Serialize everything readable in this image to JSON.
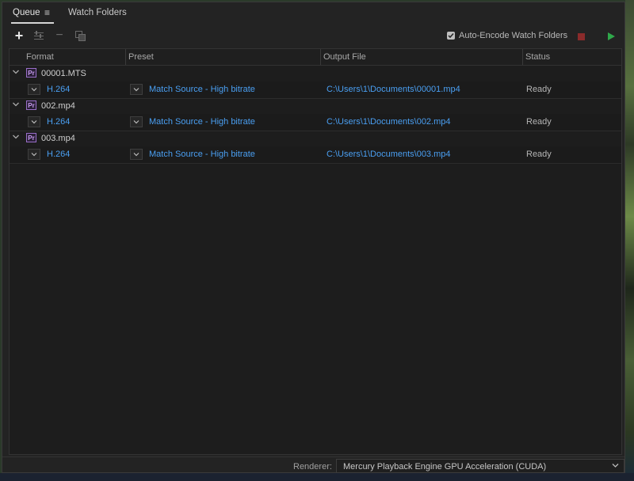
{
  "tabs": {
    "queue": "Queue",
    "menu_icon": "hamburger-menu-icon",
    "watch_folders": "Watch Folders"
  },
  "toolbar": {
    "icons": [
      "add-icon",
      "settings-icon",
      "remove-icon",
      "duplicate-icon"
    ],
    "auto_encode_label": "Auto-Encode Watch Folders",
    "auto_encode_checked": true,
    "stop_color": "#8a2b2b",
    "start_color": "#2fa84a"
  },
  "table": {
    "headers": {
      "format": "Format",
      "preset": "Preset",
      "output": "Output File",
      "status": "Status"
    },
    "groups": [
      {
        "name": "00001.MTS",
        "format": "H.264",
        "preset": "Match Source - High bitrate",
        "output": "C:\\Users\\1\\Documents\\00001.mp4",
        "status": "Ready"
      },
      {
        "name": "002.mp4",
        "format": "H.264",
        "preset": "Match Source - High bitrate",
        "output": "C:\\Users\\1\\Documents\\002.mp4",
        "status": "Ready"
      },
      {
        "name": "003.mp4",
        "format": "H.264",
        "preset": "Match Source - High bitrate",
        "output": "C:\\Users\\1\\Documents\\003.mp4",
        "status": "Ready"
      }
    ]
  },
  "footer": {
    "renderer_label": "Renderer:",
    "renderer_value": "Mercury Playback Engine GPU Acceleration (CUDA)"
  },
  "colors": {
    "link": "#4a9ff2",
    "premiere_icon": "#9a6fc9"
  }
}
